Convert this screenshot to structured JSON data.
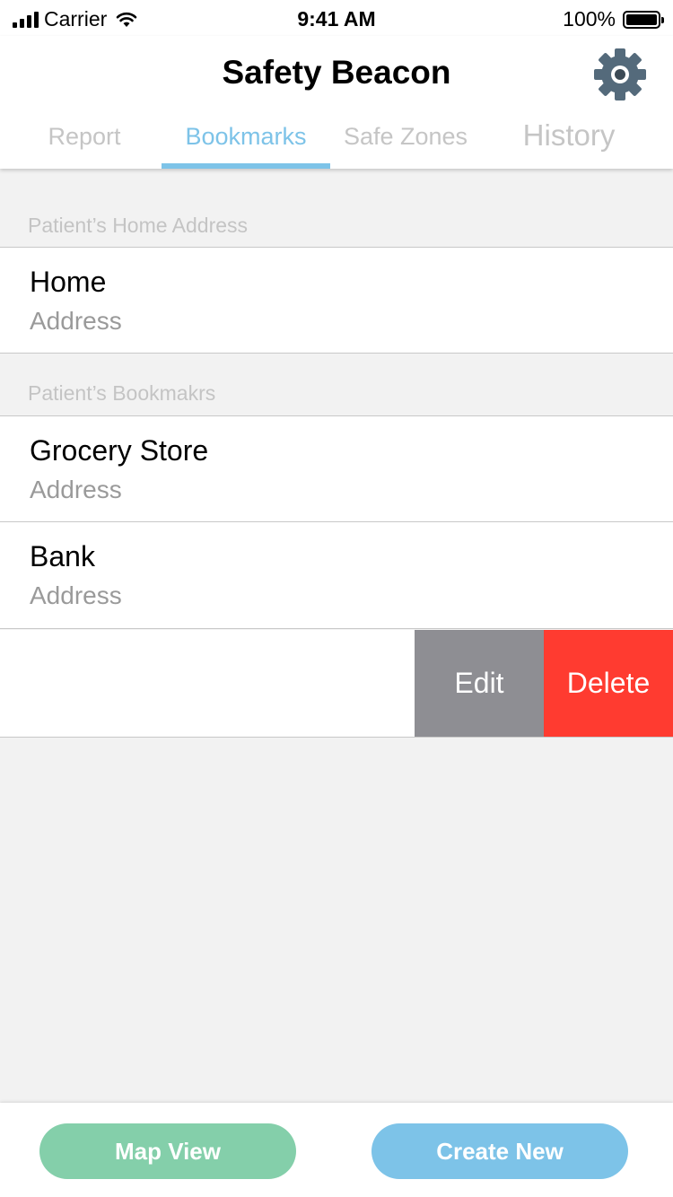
{
  "status_bar": {
    "carrier": "Carrier",
    "time": "9:41 AM",
    "battery": "100%"
  },
  "header": {
    "title": "Safety Beacon",
    "settings_icon": "gear-icon"
  },
  "tabs": [
    {
      "label": "Report",
      "active": false
    },
    {
      "label": "Bookmarks",
      "active": true
    },
    {
      "label": "Safe Zones",
      "active": false
    },
    {
      "label": "History",
      "active": false
    }
  ],
  "sections": {
    "home": {
      "label": "Patient’s Home Address",
      "items": [
        {
          "title": "Home",
          "subtitle": "Address"
        }
      ]
    },
    "bookmarks": {
      "label": "Patient’s Bookmakrs",
      "items": [
        {
          "title": "Grocery Store",
          "subtitle": "Address"
        },
        {
          "title": "Bank",
          "subtitle": "Address"
        }
      ]
    }
  },
  "swipe_actions": {
    "edit": "Edit",
    "delete": "Delete"
  },
  "bottom_bar": {
    "map_view": "Map View",
    "create_new": "Create New"
  },
  "colors": {
    "accent": "#7dc3e8",
    "map_button": "#84cfaa",
    "create_button": "#7dc3e8",
    "edit_button": "#8e8e93",
    "delete_button": "#ff3b30",
    "gear": "#546a7b"
  }
}
